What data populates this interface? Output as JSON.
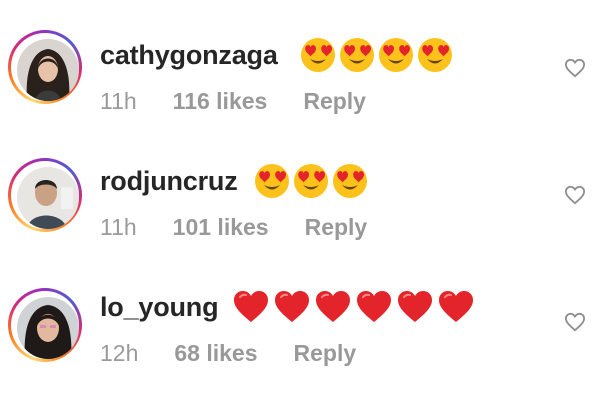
{
  "comments": [
    {
      "username": "cathygonzaga",
      "emoji_icon": "heart-eyes-emoji",
      "emoji_count": 4,
      "time": "11h",
      "likes": "116 likes",
      "reply_label": "Reply"
    },
    {
      "username": "rodjuncruz",
      "emoji_icon": "heart-eyes-emoji",
      "emoji_count": 3,
      "time": "11h",
      "likes": "101 likes",
      "reply_label": "Reply"
    },
    {
      "username": "lo_young",
      "emoji_icon": "red-heart-emoji",
      "emoji_count": 6,
      "time": "12h",
      "likes": "68 likes",
      "reply_label": "Reply"
    }
  ],
  "like_button_icon": "heart-outline-icon",
  "colors": {
    "username": "#262626",
    "meta": "#999999",
    "emoji_face": "#fcc21b",
    "heart_red": "#e3242b",
    "story_ring": "#d62976"
  }
}
